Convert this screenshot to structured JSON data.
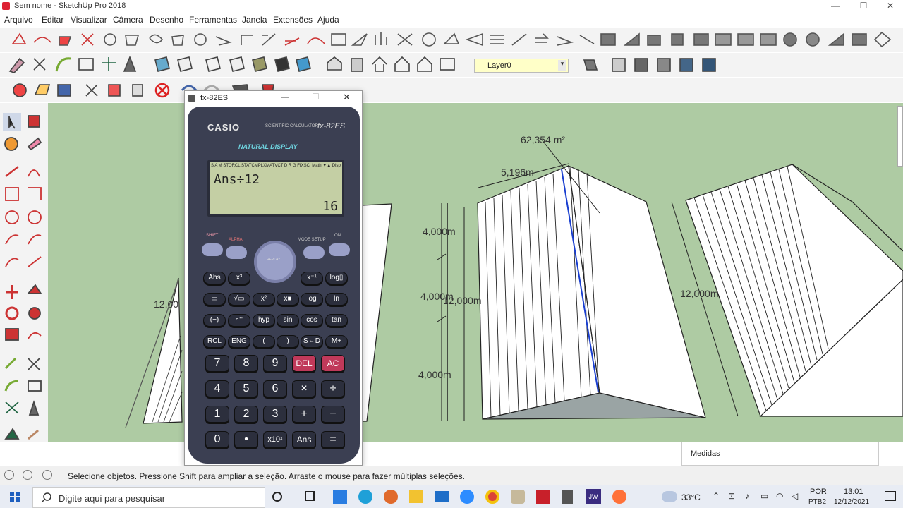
{
  "window": {
    "title": "Sem nome - SketchUp Pro 2018",
    "minimize": "—",
    "maximize": "☐",
    "close": "✕"
  },
  "menu": [
    "Arquivo",
    "Editar",
    "Visualizar",
    "Câmera",
    "Desenho",
    "Ferramentas",
    "Janela",
    "Extensões",
    "Ajuda"
  ],
  "layer": {
    "label": "Layer0"
  },
  "drawing": {
    "area_label": "62,354 m²",
    "width_label": "5,196m",
    "height_labels": [
      "4,000m",
      "4,000m",
      "4,000m"
    ],
    "total_left": "12,000m",
    "total_mid": "12,000m",
    "total_right": "12,000m",
    "left_partial": "12,00"
  },
  "calculator": {
    "window_title": "fx-82ES",
    "brand": "CASIO",
    "subtitle": "SCIENTIFIC CALCULATOR",
    "model": "fx-82ES",
    "natural": "NATURAL DISPLAY",
    "indicators": "S A M STORCL STATCMPLXMATVCT D R G FIXSCI Math ▼▲ Disp",
    "expression": "Ans÷12",
    "result": "16",
    "top_labels": {
      "shift": "SHIFT",
      "alpha": "ALPHA",
      "mode": "MODE SETUP",
      "on": "ON",
      "replay": "REPLAY"
    },
    "func_rows": [
      [
        "Abs",
        "x³",
        "x⁻¹",
        "log▯"
      ],
      [
        "▭",
        "√▭",
        "x²",
        "x■",
        "log",
        "ln"
      ],
      [
        "(−)",
        "∘'''",
        "hyp",
        "sin",
        "cos",
        "tan"
      ],
      [
        "RCL",
        "ENG",
        "(",
        ")",
        "S⇔D",
        "M+"
      ]
    ],
    "num_rows": [
      [
        "7",
        "8",
        "9",
        "DEL",
        "AC"
      ],
      [
        "4",
        "5",
        "6",
        "×",
        "÷"
      ],
      [
        "1",
        "2",
        "3",
        "+",
        "−"
      ],
      [
        "0",
        "•",
        "x10ˣ",
        "Ans",
        "="
      ]
    ]
  },
  "status": {
    "message": "Selecione objetos. Pressione Shift para ampliar a seleção. Arraste o mouse para fazer múltiplas seleções."
  },
  "medidas": {
    "label": "Medidas"
  },
  "taskbar": {
    "search_placeholder": "Digite aqui para pesquisar",
    "temp": "33°C",
    "lang1": "POR",
    "lang2": "PTB2",
    "time": "13:01",
    "date": "12/12/2021"
  }
}
